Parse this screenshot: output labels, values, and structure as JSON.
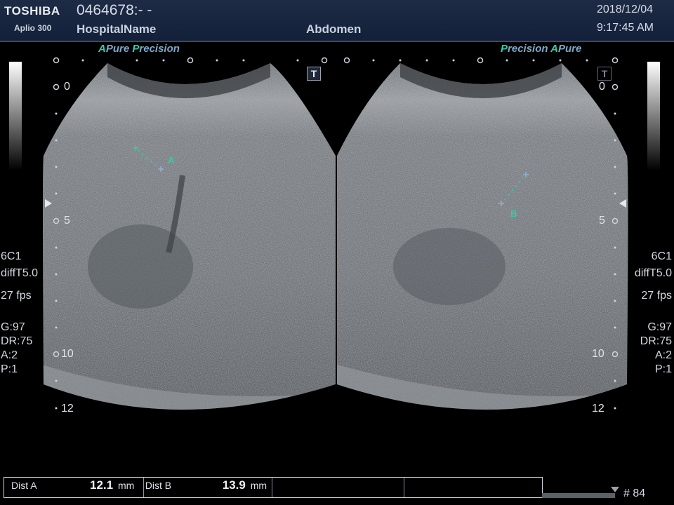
{
  "header": {
    "brand": "TOSHIBA",
    "model": "Aplio 300",
    "patient_id": "0464678:- -",
    "hospital": "HospitalName",
    "exam": "Abdomen",
    "date": "2018/12/04",
    "time": "9:17:45 AM"
  },
  "left_pane": {
    "mode_label_a": "A",
    "mode_label_pure": "Pure",
    "mode_label_p": "P",
    "mode_label_recision": "recision",
    "t_marker": "T",
    "caliper_label": "A",
    "depth_0": "0",
    "depth_5": "5",
    "depth_10": "10",
    "depth_12": "12",
    "params": {
      "probe": "6C1",
      "filter": "diffT5.0",
      "fps": "27 fps",
      "gain": "G:97",
      "dr": "DR:75",
      "a": "A:2",
      "p": "P:1"
    }
  },
  "right_pane": {
    "mode_label_p": "P",
    "mode_label_recision": "recision",
    "mode_label_a": "A",
    "mode_label_pure": "Pure",
    "t_marker": "T",
    "caliper_label": "B",
    "depth_0": "0",
    "depth_5": "5",
    "depth_10": "10",
    "depth_12": "12",
    "params": {
      "probe": "6C1",
      "filter": "diffT5.0",
      "fps": "27 fps",
      "gain": "G:97",
      "dr": "DR:75",
      "a": "A:2",
      "p": "P:1"
    }
  },
  "measurements": {
    "dist_a_label": "Dist A",
    "dist_a_value": "12.1",
    "dist_a_unit": "mm",
    "dist_b_label": "Dist B",
    "dist_b_value": "13.9",
    "dist_b_unit": "mm"
  },
  "cine": {
    "frame_label": "# 84"
  },
  "colors": {
    "caliper": "#2ecfa8",
    "header_bg": "#1d2b45",
    "accent_blue": "#7fa7c9"
  }
}
